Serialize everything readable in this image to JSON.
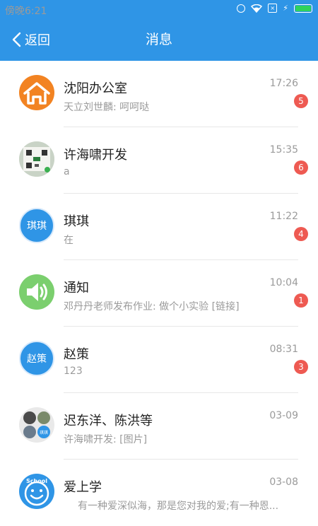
{
  "statusbar": {
    "time": "傍晚6:21"
  },
  "header": {
    "back_label": "返回",
    "title": "消息"
  },
  "colors": {
    "primary": "#2f95e6",
    "badge": "#ee5a52",
    "notify_green": "#7bcf6e",
    "home_orange": "#f28322"
  },
  "conversations": [
    {
      "name": "沈阳办公室",
      "preview": "天立刘世麟: 呵呵哒",
      "time": "17:26",
      "unread": "5",
      "avatar_icon": "house-icon"
    },
    {
      "name": "许海啸开发",
      "preview": "a",
      "time": "15:35",
      "unread": "6",
      "avatar_icon": "photo-avatar"
    },
    {
      "name": "琪琪",
      "preview": "在",
      "time": "11:22",
      "unread": "4",
      "avatar_text": "琪琪"
    },
    {
      "name": "通知",
      "preview": "邓丹丹老师发布作业: 做个小实验 [链接]",
      "time": "10:04",
      "unread": "1",
      "avatar_icon": "speaker-icon"
    },
    {
      "name": "赵策",
      "preview": "123",
      "time": "08:31",
      "unread": "3",
      "avatar_text": "赵策"
    },
    {
      "name": "迟东洋、陈洪等",
      "preview": "许海啸开发: [图片]",
      "time": "03-09",
      "unread": "",
      "avatar_icon": "group-avatar",
      "group_small_label": "琪琪"
    },
    {
      "name": "爱上学",
      "preview": "有一种爱深似海，那是您对我的爱;有一种恩...",
      "time": "03-08",
      "unread": "",
      "avatar_icon": "smiley-school-icon",
      "avatar_caption": "School"
    }
  ]
}
